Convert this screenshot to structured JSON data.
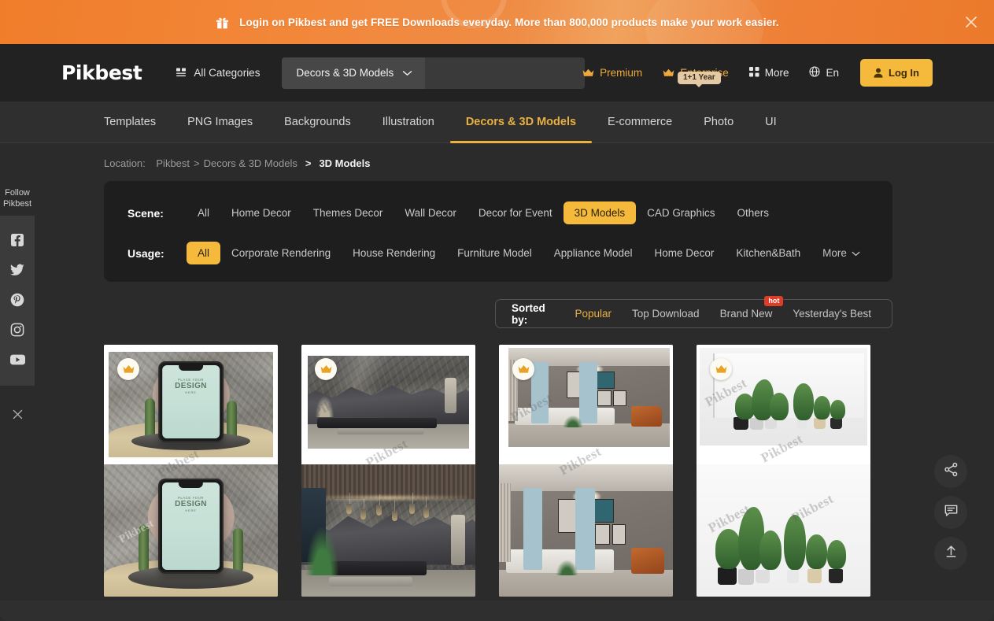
{
  "promo": {
    "text": "Login on Pikbest and get FREE Downloads everyday. More than 800,000 products make your work easier.",
    "gift_icon": "gift-icon",
    "close_icon": "close-icon",
    "bg_color": "#ef8234"
  },
  "header": {
    "logo": "Pikbest",
    "all_categories": "All Categories",
    "search": {
      "category": "Decors & 3D Models",
      "value": "",
      "placeholder": "",
      "search_icon": "search-icon"
    },
    "right_items": [
      {
        "label": "Premium",
        "icon": "crown-icon",
        "badge": ""
      },
      {
        "label": "Enterprise",
        "icon": "crown-icon",
        "badge": "1+1 Year"
      },
      {
        "label": "More",
        "icon": "grid-icon",
        "badge": ""
      },
      {
        "label": "En",
        "icon": "globe-icon",
        "badge": ""
      }
    ],
    "login_label": "Log In",
    "login_color": "#f5b93c"
  },
  "nav": {
    "items": [
      {
        "label": "Templates",
        "active": false
      },
      {
        "label": "PNG Images",
        "active": false
      },
      {
        "label": "Backgrounds",
        "active": false
      },
      {
        "label": "Illustration",
        "active": false
      },
      {
        "label": "Decors & 3D Models",
        "active": true
      },
      {
        "label": "E-commerce",
        "active": false
      },
      {
        "label": "Photo",
        "active": false
      },
      {
        "label": "UI",
        "active": false
      }
    ],
    "active_color": "#eab040"
  },
  "breadcrumb": {
    "prefix": "Location:",
    "root": "Pikbest",
    "sep": ">",
    "parent": "Decors & 3D Models",
    "sep2": ">",
    "current": "3D Models"
  },
  "filters": {
    "scene": {
      "label": "Scene:",
      "items": [
        "All",
        "Home Decor",
        "Themes Decor",
        "Wall Decor",
        "Decor for Event",
        "3D Models",
        "CAD Graphics",
        "Others"
      ],
      "active": "3D Models"
    },
    "usage": {
      "label": "Usage:",
      "items": [
        "All",
        "Corporate Rendering",
        "House Rendering",
        "Furniture Model",
        "Appliance Model",
        "Home Decor",
        "Kitchen&Bath"
      ],
      "active": "All",
      "more_label": "More"
    },
    "active_color": "#f5b93c"
  },
  "sortbar": {
    "label": "Sorted by:",
    "options": [
      {
        "label": "Popular",
        "active": true,
        "badge": ""
      },
      {
        "label": "Top Download",
        "active": false,
        "badge": ""
      },
      {
        "label": "Brand New",
        "active": false,
        "badge": "hot"
      },
      {
        "label": "Yesterday's Best",
        "active": false,
        "badge": ""
      }
    ],
    "active_color": "#eab040",
    "badge_color": "#e03d28"
  },
  "social_rail": {
    "title": "Follow\nPikbest",
    "title_line1": "Follow",
    "title_line2": "Pikbest",
    "items": [
      {
        "name": "facebook-icon"
      },
      {
        "name": "twitter-icon"
      },
      {
        "name": "pinterest-icon"
      },
      {
        "name": "instagram-icon"
      },
      {
        "name": "youtube-icon"
      }
    ],
    "close_icon": "close-icon"
  },
  "float_buttons": [
    {
      "name": "share-icon"
    },
    {
      "name": "feedback-icon"
    },
    {
      "name": "scroll-top-icon"
    }
  ],
  "cards": [
    {
      "id": 1,
      "badge_icon": "crown-icon",
      "watermark": "Pikbest",
      "scene": "cactus-phone-mockup"
    },
    {
      "id": 2,
      "badge_icon": "crown-icon",
      "watermark": "Pikbest",
      "scene": "stone-wall-living-room"
    },
    {
      "id": 3,
      "badge_icon": "crown-icon",
      "watermark": "Pikbest",
      "scene": "grey-living-room"
    },
    {
      "id": 4,
      "badge_icon": "crown-icon",
      "watermark": "Pikbest",
      "scene": "potted-plants"
    }
  ]
}
